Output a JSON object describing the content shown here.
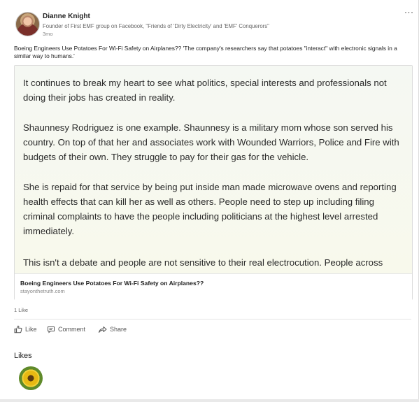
{
  "author": {
    "name": "Dianne Knight",
    "headline": "Founder of First EMF group on Facebook, \"Friends of 'Dirty Electricity' and 'EMF' Conquerors\"",
    "age": "3mo"
  },
  "menu": {
    "more_label": "···"
  },
  "post": {
    "text": "Boeing Engineers Use Potatoes For Wi-Fi Safety on Airplanes?? 'The company's researchers say that potatoes \"interact\" with electronic signals in a similar way to humans.'"
  },
  "article": {
    "paragraphs": [
      "It continues to break my heart to see what politics, special interests and professionals not doing their jobs has created in reality.",
      "Shaunnesy Rodriguez is one example. Shaunnesy is a military mom whose son served his country. On top of that her and associates work with Wounded Warriors, Police and Fire with budgets of their own. They struggle to pay for their gas for the vehicle.",
      "She is repaid for that service by being put inside man made microwave ovens and reporting health effects that can kill her as well as others. People need to step up including filing criminal complaints to have the people including politicians at the highest level arrested immediately.",
      "This isn't a debate and people are not sensitive to their real electrocution. People across"
    ],
    "title": "Boeing Engineers Use Potatoes For Wi-Fi Safety on Airplanes??",
    "domain": "stayonthetruth.com"
  },
  "social": {
    "likes_count": "1 Like",
    "actions": {
      "like": "Like",
      "comment": "Comment",
      "share": "Share"
    },
    "likes_heading": "Likes"
  },
  "colors": {
    "article_bg": "#f6f8ef",
    "text": "#222222",
    "muted": "#666666"
  },
  "icons": [
    "thumbs-up-icon",
    "comment-icon",
    "share-icon",
    "more-icon"
  ]
}
